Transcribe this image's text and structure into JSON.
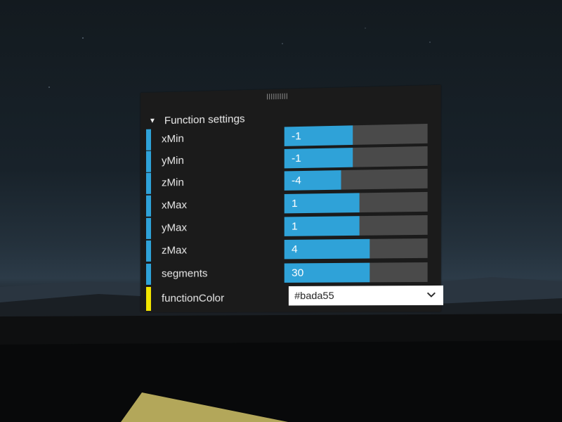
{
  "panel": {
    "section_title": "Function settings",
    "sliders": [
      {
        "label": "xMin",
        "value": "-1",
        "fill": 0.48
      },
      {
        "label": "yMin",
        "value": "-1",
        "fill": 0.48
      },
      {
        "label": "zMin",
        "value": "-4",
        "fill": 0.4
      },
      {
        "label": "xMax",
        "value": "1",
        "fill": 0.53
      },
      {
        "label": "yMax",
        "value": "1",
        "fill": 0.53
      },
      {
        "label": "zMax",
        "value": "4",
        "fill": 0.6
      },
      {
        "label": "segments",
        "value": "30",
        "fill": 0.6
      }
    ],
    "color_control": {
      "label": "functionColor",
      "value": "#bada55"
    }
  },
  "icons": {
    "collapse": "triangle-down-icon",
    "grip": "drag-handle-icon",
    "dropdown": "chevron-down-icon"
  },
  "colors": {
    "accent": "#2fa2d8",
    "color_stripe": "#f2e500",
    "floor_object": "#b3a75a"
  }
}
